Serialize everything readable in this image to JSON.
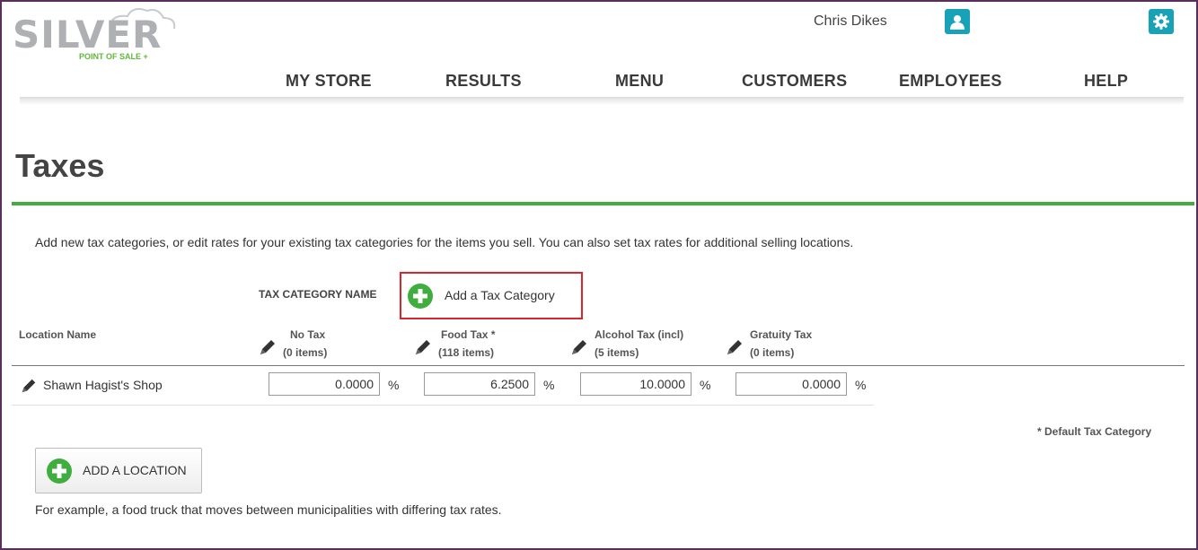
{
  "app": {
    "logo_text": "SILVER",
    "logo_subtext": "POINT OF SALE +",
    "user_name": "Chris Dikes"
  },
  "nav": {
    "items": [
      {
        "label": "MY STORE"
      },
      {
        "label": "RESULTS"
      },
      {
        "label": "MENU"
      },
      {
        "label": "CUSTOMERS"
      },
      {
        "label": "EMPLOYEES"
      },
      {
        "label": "HELP"
      }
    ]
  },
  "page": {
    "title": "Taxes",
    "intro": "Add new tax categories, or edit rates for your existing tax categories for the items you sell. You can also set tax rates for additional selling locations.",
    "tax_category_name_label": "TAX CATEGORY NAME",
    "add_tax_category_label": "Add a Tax Category",
    "location_name_header": "Location Name",
    "columns": [
      {
        "name": "No Tax",
        "count": "(0 items)"
      },
      {
        "name": "Food Tax *",
        "count": "(118 items)"
      },
      {
        "name": "Alcohol Tax (incl)",
        "count": "(5 items)"
      },
      {
        "name": "Gratuity Tax",
        "count": "(0 items)"
      }
    ],
    "rows": [
      {
        "location": "Shawn Hagist's Shop",
        "rates": [
          "0.0000",
          "6.2500",
          "10.0000",
          "0.0000"
        ],
        "unit": "%"
      }
    ],
    "default_note": "* Default Tax Category",
    "add_location_label": "ADD A LOCATION",
    "footer_note": "For example, a food truck that moves between municipalities with differing tax rates."
  },
  "colors": {
    "accent_green": "#3fae3f",
    "teal": "#17a2b8",
    "highlight_red": "#d9262c"
  },
  "icons": [
    "user-icon",
    "gear-icon",
    "pencil-icon",
    "plus-icon"
  ]
}
